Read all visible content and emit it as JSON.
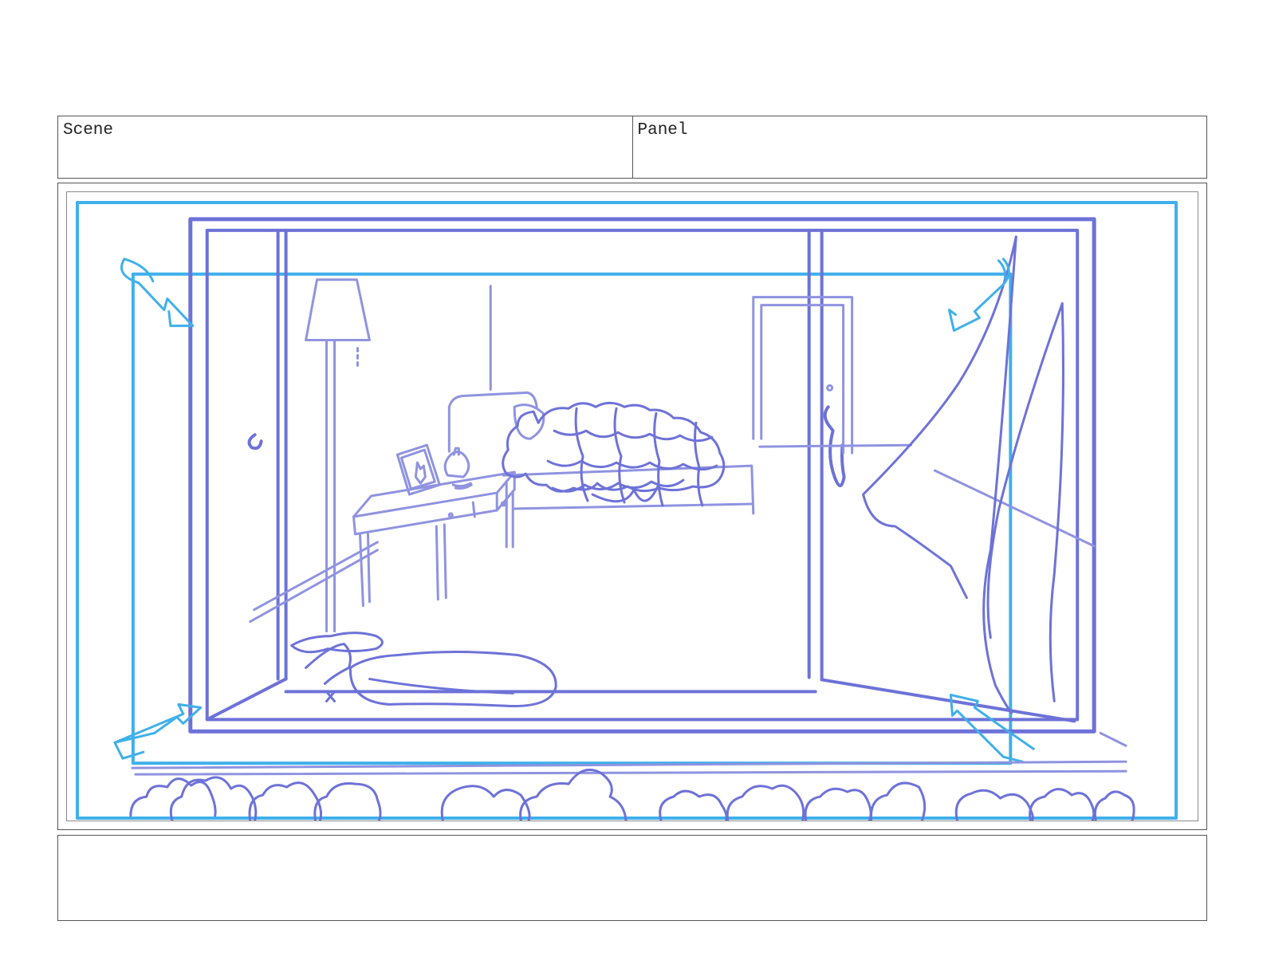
{
  "header": {
    "scene_label": "Scene",
    "panel_label": "Panel"
  },
  "notes": {
    "text": ""
  },
  "colors": {
    "outline_purple": "#6d72d8",
    "camera_frame_blue": "#3fb0ea",
    "light_purple": "#8f93e0"
  }
}
